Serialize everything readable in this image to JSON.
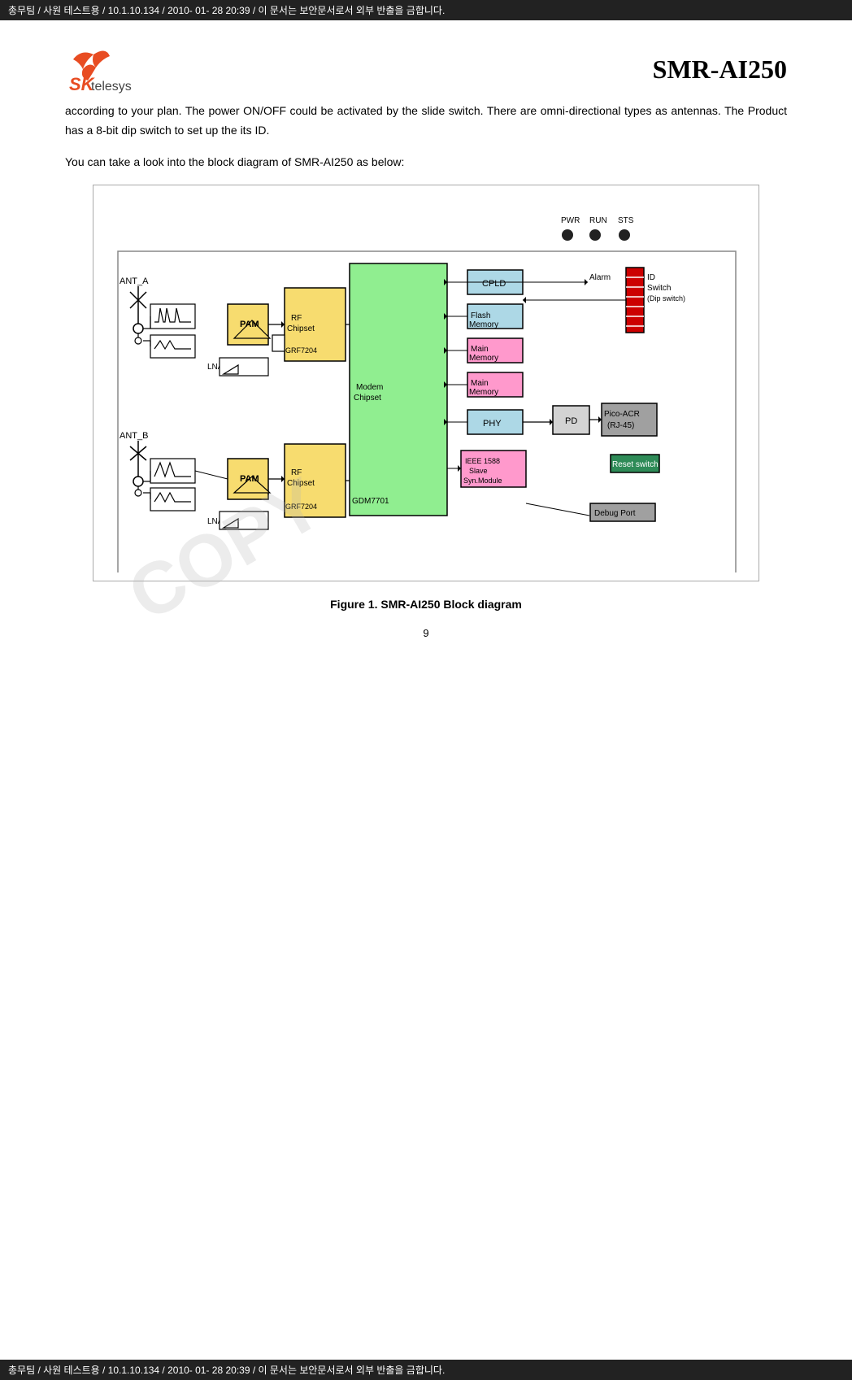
{
  "header": {
    "text": "총무팀 / 사원 테스트용 / 10.1.10.134 / 2010- 01- 28 20:39 /  이 문서는 보안문서로서 외부 반출을 금합니다."
  },
  "footer": {
    "text": "총무팀 / 사원 테스트용 / 10.1.10.134 / 2010- 01- 28 20:39 /  이 문서는 보안문서로서 외부 반출을 금합니다."
  },
  "logo": {
    "brand": "SK",
    "sub": "telesys",
    "model": "SMR-AI250"
  },
  "body_text": "according to your plan. The power ON/OFF could be activated by the slide switch. There are omni-directional types as antennas. The Product has a 8-bit dip switch to set up the its ID.",
  "diagram_intro": "You can take a look into the block diagram of SMR-AI250 as below:",
  "figure_caption": "Figure 1. SMR-AI250 Block diagram",
  "page_number": "9",
  "watermark": "COPY",
  "diagram": {
    "labels": {
      "ant_a": "ANT_A",
      "ant_b": "ANT_B",
      "pam": "PAM",
      "lna": "LNA",
      "rf_chipset": "RF\nChipset",
      "grf7204_top": "GRF7204",
      "grf7204_bot": "GRF7204",
      "modem_chipset": "Modem\nChipset",
      "gdm7701": "GDM7701",
      "cpld": "CPLD",
      "flash_memory": "Flash\nMemory",
      "main_memory_1": "Main\nMemory",
      "main_memory_2": "Main\nMemory",
      "phy": "PHY",
      "pd": "PD",
      "ieee": "IEEE 1588\nSlave\nSyn.Module",
      "alarm": "Alarm",
      "id_switch": "ID\nSwitch\n(Dip switch)",
      "pico_acr": "Pico-ACR\n(RJ-45)",
      "reset_switch": "Reset switch",
      "debug_port": "Debug Port",
      "pwr": "PWR",
      "run": "RUN",
      "sts": "STS"
    }
  }
}
